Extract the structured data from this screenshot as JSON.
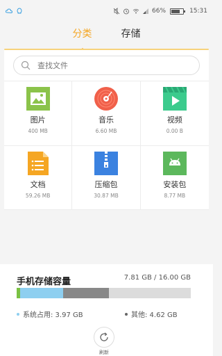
{
  "status_bar": {
    "battery": "66%",
    "time": "15:31"
  },
  "tabs": [
    {
      "label": "分类",
      "active": true
    },
    {
      "label": "存储",
      "active": false
    }
  ],
  "search": {
    "placeholder": "查找文件"
  },
  "categories": [
    {
      "name": "图片",
      "size": "400 MB",
      "icon": "image-icon",
      "color": "#8bc34a"
    },
    {
      "name": "音乐",
      "size": "6.60 MB",
      "icon": "music-disc-icon",
      "color": "#f0604a"
    },
    {
      "name": "视频",
      "size": "0.00 B",
      "icon": "video-icon",
      "color": "#3ccb8d"
    },
    {
      "name": "文档",
      "size": "59.26 MB",
      "icon": "document-icon",
      "color": "#f5a623"
    },
    {
      "name": "压缩包",
      "size": "30.87 MB",
      "icon": "zip-icon",
      "color": "#3b82e0"
    },
    {
      "name": "安装包",
      "size": "8.77 MB",
      "icon": "android-icon",
      "color": "#5cb85c"
    }
  ],
  "storage": {
    "title": "手机存储容量",
    "amount": "7.81 GB / 16.00 GB",
    "used_fraction": 0.488,
    "segments": [
      {
        "name": "other-green",
        "color": "#7ac143",
        "fraction": 0.02
      },
      {
        "name": "system",
        "color": "#8ecff0",
        "fraction": 0.248
      },
      {
        "name": "other",
        "color": "#888888",
        "fraction": 0.262
      }
    ],
    "legend": [
      {
        "label": "系统占用:  3.97 GB",
        "color": "#8ecff0"
      },
      {
        "label": "其他:  4.62 GB",
        "color": "#666666"
      }
    ]
  },
  "refresh_label": "刷新"
}
